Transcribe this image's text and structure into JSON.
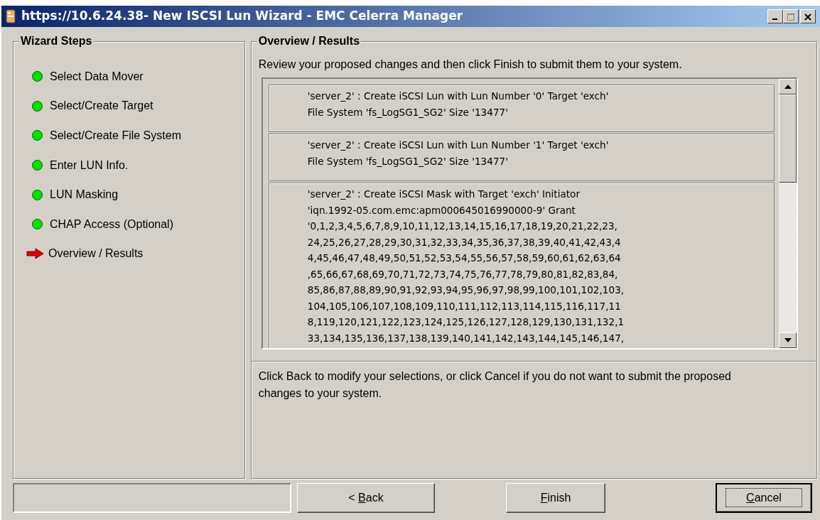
{
  "window": {
    "title": "https://10.6.24.38- New ISCSI Lun Wizard - EMC Celerra Manager",
    "controls": [
      {
        "kind": "minimize",
        "disabled": false
      },
      {
        "kind": "maximize",
        "disabled": true
      },
      {
        "kind": "close",
        "disabled": false
      }
    ]
  },
  "steps_panel": {
    "title": "Wizard Steps",
    "steps": [
      {
        "label": "Select Data Mover",
        "kind": "done"
      },
      {
        "label": "Select/Create Target",
        "kind": "done"
      },
      {
        "label": "Select/Create File System",
        "kind": "done"
      },
      {
        "label": "Enter LUN Info.",
        "kind": "done"
      },
      {
        "label": "LUN Masking",
        "kind": "done"
      },
      {
        "label": "CHAP Access (Optional)",
        "kind": "done"
      },
      {
        "label": "Overview / Results",
        "kind": "current"
      }
    ]
  },
  "results_panel": {
    "title": "Overview / Results",
    "intro": "Review your proposed changes and then click Finish to submit them to your system.",
    "changes": [
      {
        "lines": [
          "'server_2' : Create iSCSI Lun with Lun Number '0' Target 'exch'",
          "File System 'fs_LogSG1_SG2' Size '13477'"
        ]
      },
      {
        "lines": [
          "'server_2' : Create iSCSI Lun with Lun Number '1' Target 'exch'",
          "File System 'fs_LogSG1_SG2' Size '13477'"
        ]
      },
      {
        "lines": [
          "'server_2' : Create iSCSI Mask with Target 'exch' Initiator",
          "'iqn.1992-05.com.emc:apm000645016990000-9' Grant",
          "'0,1,2,3,4,5,6,7,8,9,10,11,12,13,14,15,16,17,18,19,20,21,22,23,",
          "24,25,26,27,28,29,30,31,32,33,34,35,36,37,38,39,40,41,42,43,4",
          "4,45,46,47,48,49,50,51,52,53,54,55,56,57,58,59,60,61,62,63,64",
          ",65,66,67,68,69,70,71,72,73,74,75,76,77,78,79,80,81,82,83,84,",
          "85,86,87,88,89,90,91,92,93,94,95,96,97,98,99,100,101,102,103,",
          "104,105,106,107,108,109,110,111,112,113,114,115,116,117,11",
          "8,119,120,121,122,123,124,125,126,127,128,129,130,131,132,1",
          "33,134,135,136,137,138,139,140,141,142,143,144,145,146,147,"
        ]
      }
    ],
    "footer": "Click Back to modify your selections, or click Cancel if you do not want to submit the proposed changes to your system."
  },
  "buttons": [
    {
      "label_before": "< ",
      "access_key": "B",
      "label_after": "ack",
      "focused": false
    },
    {
      "access_key": "F",
      "label_after": "inish",
      "focused": false
    },
    {
      "access_key": "C",
      "label_after": "ancel",
      "focused": true
    }
  ]
}
